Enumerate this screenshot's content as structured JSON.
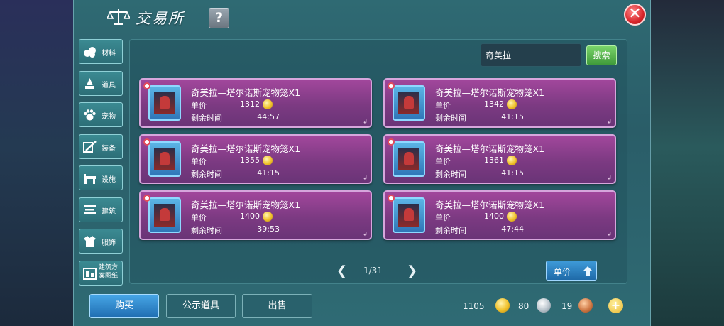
{
  "header": {
    "title": "交易所",
    "help_label": "?",
    "close_label": "✕"
  },
  "sidebar": {
    "items": [
      {
        "label": "材料",
        "icon": "material-icon"
      },
      {
        "label": "道具",
        "icon": "item-icon"
      },
      {
        "label": "宠物",
        "icon": "pet-paw-icon"
      },
      {
        "label": "装备",
        "icon": "equipment-icon"
      },
      {
        "label": "设施",
        "icon": "facility-icon"
      },
      {
        "label": "建筑",
        "icon": "building-icon"
      },
      {
        "label": "服饰",
        "icon": "clothing-icon"
      },
      {
        "label": "建筑方案图纸",
        "icon": "blueprint-icon"
      }
    ]
  },
  "search": {
    "value": "奇美拉",
    "button_label": "搜索"
  },
  "listings": [
    {
      "name": "奇美拉—塔尔诺斯宠物笼X1",
      "price_label": "单价",
      "price": "1312",
      "time_label": "剩余时间",
      "time": "44:57"
    },
    {
      "name": "奇美拉—塔尔诺斯宠物笼X1",
      "price_label": "单价",
      "price": "1342",
      "time_label": "剩余时间",
      "time": "41:15"
    },
    {
      "name": "奇美拉—塔尔诺斯宠物笼X1",
      "price_label": "单价",
      "price": "1355",
      "time_label": "剩余时间",
      "time": "41:15"
    },
    {
      "name": "奇美拉—塔尔诺斯宠物笼X1",
      "price_label": "单价",
      "price": "1361",
      "time_label": "剩余时间",
      "time": "41:15"
    },
    {
      "name": "奇美拉—塔尔诺斯宠物笼X1",
      "price_label": "单价",
      "price": "1400",
      "time_label": "剩余时间",
      "time": "39:53"
    },
    {
      "name": "奇美拉—塔尔诺斯宠物笼X1",
      "price_label": "单价",
      "price": "1400",
      "time_label": "剩余时间",
      "time": "47:44"
    }
  ],
  "pagination": {
    "prev": "❮",
    "page": "1/31",
    "next": "❯"
  },
  "sort": {
    "label": "单价",
    "icon": "sort-arrow-icon"
  },
  "tabs": {
    "buy": "购买",
    "showcase": "公示道具",
    "sell": "出售"
  },
  "currency": {
    "gold": "1105",
    "silver": "80",
    "bronze": "19",
    "add": "+"
  },
  "colors": {
    "panel": "#2a5d68",
    "card": "#7c3a82",
    "accent_blue": "#1f6db1",
    "search_green": "#3f9a3a",
    "close_red": "#d8262c"
  }
}
